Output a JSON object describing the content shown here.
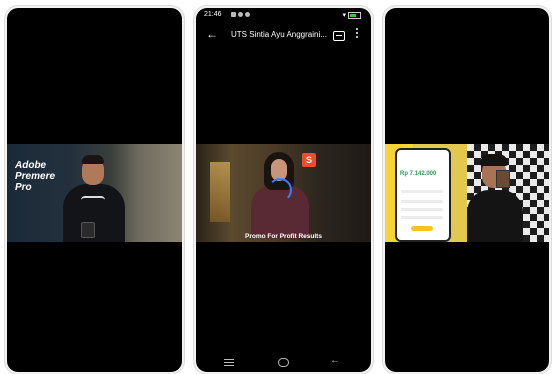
{
  "phones": [
    {
      "video_overlay_text": [
        "Adobe",
        "Premere",
        "Pro"
      ]
    },
    {
      "status_time": "21:46",
      "title": "UTS Sintia Ayu Anggraini...",
      "video_badge": "S",
      "video_caption": "Promo For Profit Results"
    },
    {
      "app_balance": "Rp 7.142.000"
    }
  ]
}
